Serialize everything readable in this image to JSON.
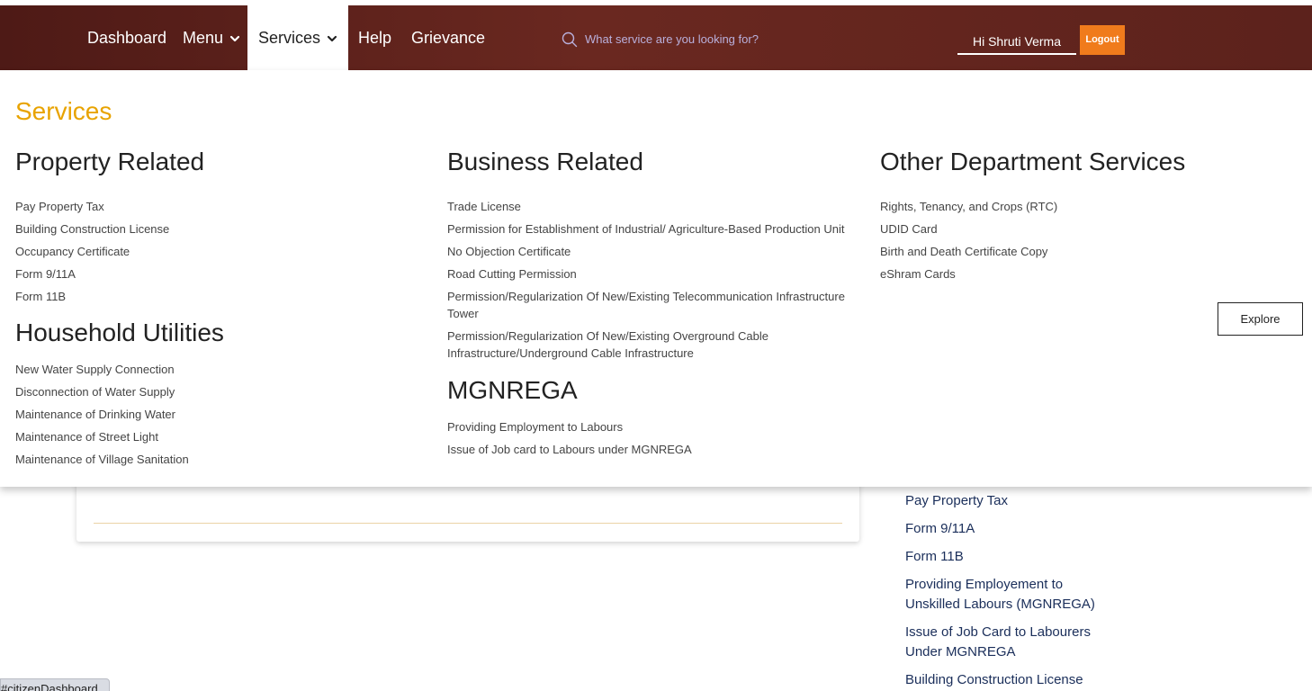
{
  "nav": {
    "items": [
      {
        "label": "Dashboard"
      },
      {
        "label": "Menu"
      },
      {
        "label": "Services"
      },
      {
        "label": "Help"
      },
      {
        "label": "Grievance"
      }
    ],
    "search_placeholder": "What service are you looking for?",
    "user_greeting": "Hi Shruti Verma",
    "logout_label": "Logout"
  },
  "dropdown": {
    "title": "Services",
    "property": {
      "heading": "Property Related",
      "items": [
        "Pay Property Tax",
        "Building Construction License",
        "Occupancy Certificate",
        "Form 9/11A",
        "Form 11B"
      ]
    },
    "household": {
      "heading": "Household Utilities",
      "items": [
        "New Water Supply Connection",
        "Disconnection of Water Supply",
        "Maintenance of Drinking Water",
        "Maintenance of Street Light",
        "Maintenance of Village Sanitation"
      ]
    },
    "business": {
      "heading": "Business Related",
      "items": [
        "Trade License",
        "Permission for Establishment of Industrial/ Agriculture-Based Production Unit",
        "No Objection Certificate",
        "Road Cutting Permission",
        "Permission/Regularization Of New/Existing Telecommunication Infrastructure Tower",
        "Permission/Regularization Of New/Existing Overground Cable Infrastructure/Underground Cable Infrastructure"
      ]
    },
    "mgnrega": {
      "heading": "MGNREGA",
      "items": [
        "Providing Employment to Labours",
        "Issue of Job card to Labours under MGNREGA"
      ]
    },
    "other": {
      "heading": "Other Department Services",
      "items": [
        "Rights, Tenancy, and Crops (RTC)",
        "UDID Card",
        "Birth and Death Certificate Copy",
        "eShram Cards"
      ]
    },
    "explore_label": "Explore"
  },
  "background": {
    "quick_links": [
      "Pay Property Tax",
      "Form 9/11A",
      "Form 11B",
      "Providing Employement to Unskilled Labours (MGNREGA)",
      "Issue of Job Card to Labourers Under MGNREGA",
      "Building Construction License"
    ],
    "status_url": "citizenDashboard#"
  },
  "colors": {
    "nav_bg": "#5c221c",
    "accent_title": "#e8a300",
    "logout_bg": "#f07b1c",
    "link_navy": "#1a2e5a"
  }
}
